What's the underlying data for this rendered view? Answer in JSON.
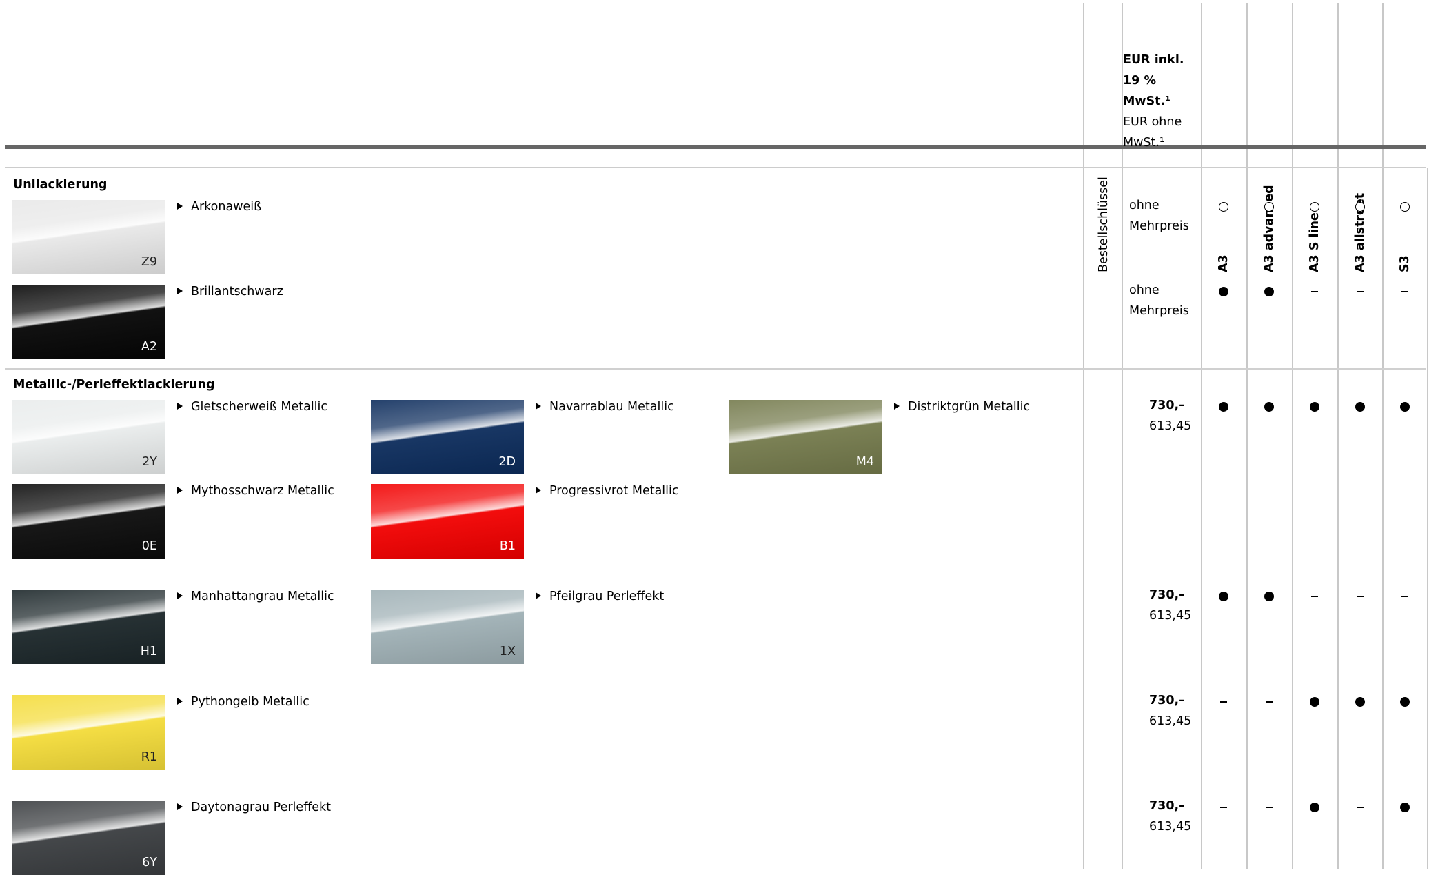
{
  "header": {
    "order_key": "Bestellschlüssel",
    "price_incl_line1": "EUR inkl.",
    "price_incl_line2": "19 % MwSt.¹",
    "price_excl_line1": "EUR ohne",
    "price_excl_line2": "MwSt.¹",
    "models": [
      "A3",
      "A3 advanced",
      "A3 S line",
      "A3 allstreet",
      "S3"
    ]
  },
  "sections": {
    "uni_title": "Unilackierung",
    "metallic_title": "Metallic-/Perleffektlackierung"
  },
  "uni_rows": [
    {
      "price_line1": "ohne",
      "price_line2": "Mehrpreis",
      "marks": [
        "optional",
        "optional",
        "optional",
        "optional",
        "optional"
      ],
      "colors": [
        {
          "name": "Arkonaweiß",
          "code": "Z9"
        }
      ]
    },
    {
      "price_line1": "ohne",
      "price_line2": "Mehrpreis",
      "marks": [
        "standard",
        "standard",
        "none",
        "none",
        "none"
      ],
      "colors": [
        {
          "name": "Brillantschwarz",
          "code": "A2"
        }
      ]
    }
  ],
  "metallic_rows": [
    {
      "price_incl": "730,–",
      "price_excl": "613,45",
      "marks": [
        "standard",
        "standard",
        "standard",
        "standard",
        "standard"
      ],
      "colors": [
        {
          "name": "Gletscherweiß Metallic",
          "code": "2Y"
        },
        {
          "name": "Navarrablau Metallic",
          "code": "2D"
        },
        {
          "name": "Distriktgrün Metallic",
          "code": "M4"
        },
        {
          "name": "Mythosschwarz Metallic",
          "code": "0E"
        },
        {
          "name": "Progressivrot Metallic",
          "code": "B1"
        }
      ]
    },
    {
      "price_incl": "730,–",
      "price_excl": "613,45",
      "marks": [
        "standard",
        "standard",
        "none",
        "none",
        "none"
      ],
      "colors": [
        {
          "name": "Manhattangrau Metallic",
          "code": "H1"
        },
        {
          "name": "Pfeilgrau Perleffekt",
          "code": "1X"
        }
      ]
    },
    {
      "price_incl": "730,–",
      "price_excl": "613,45",
      "marks": [
        "none",
        "none",
        "standard",
        "standard",
        "standard"
      ],
      "colors": [
        {
          "name": "Pythongelb Metallic",
          "code": "R1"
        }
      ]
    },
    {
      "price_incl": "730,–",
      "price_excl": "613,45",
      "marks": [
        "none",
        "none",
        "standard",
        "none",
        "standard"
      ],
      "colors": [
        {
          "name": "Daytonagrau Perleffekt",
          "code": "6Y"
        }
      ]
    }
  ],
  "legend_icons": {
    "standard": "filled-circle-icon",
    "optional": "open-circle-icon",
    "none": "dash-icon"
  },
  "swatch_colors": {
    "Z9": "#e8e8e8",
    "A2": "#050505",
    "2Y": "#e9ecec",
    "2D": "#0c2c5c",
    "M4": "#747a4c",
    "0E": "#0b0b0b",
    "B1": "#f20000",
    "H1": "#1b2629",
    "1X": "#9fb0b5",
    "R1": "#f4dc3a",
    "6Y": "#3a3d40"
  }
}
